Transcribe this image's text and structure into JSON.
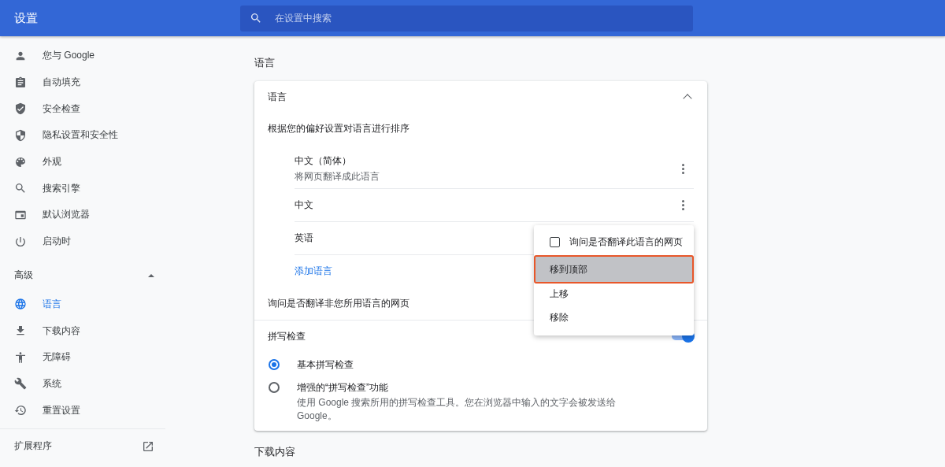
{
  "header": {
    "title": "设置",
    "search": {
      "placeholder": "在设置中搜索"
    }
  },
  "sidebar": {
    "items": [
      {
        "label": "您与 Google",
        "selected": false
      },
      {
        "label": "自动填充",
        "selected": false
      },
      {
        "label": "安全检查",
        "selected": false
      },
      {
        "label": "隐私设置和安全性",
        "selected": false
      },
      {
        "label": "外观",
        "selected": false
      },
      {
        "label": "搜索引擎",
        "selected": false
      },
      {
        "label": "默认浏览器",
        "selected": false
      },
      {
        "label": "启动时",
        "selected": false
      }
    ],
    "advanced": {
      "label": "高级",
      "expanded": true,
      "items": [
        {
          "label": "语言",
          "selected": true
        },
        {
          "label": "下载内容",
          "selected": false
        },
        {
          "label": "无障碍",
          "selected": false
        },
        {
          "label": "系统",
          "selected": false
        },
        {
          "label": "重置设置",
          "selected": false
        }
      ]
    },
    "extensions": {
      "label": "扩展程序"
    }
  },
  "main": {
    "section_title": "语言",
    "card": {
      "title": "语言",
      "expanded": true,
      "order_label": "根据您的偏好设置对语言进行排序",
      "languages": [
        {
          "name": "中文（简体）",
          "subtitle": "将网页翻译成此语言"
        },
        {
          "name": "中文"
        },
        {
          "name": "英语"
        }
      ],
      "add_link": "添加语言",
      "translate_offer": {
        "label": "询问是否翻译非您所用语言的网页"
      },
      "spellcheck": {
        "label": "拼写检查",
        "on": true,
        "options": [
          {
            "label": "基本拼写检查",
            "selected": true
          },
          {
            "label": "增强的“拼写检查”功能",
            "description": "使用 Google 搜索所用的拼写检查工具。您在浏览器中输入的文字会被发送给Google。",
            "selected": false
          }
        ]
      }
    },
    "next_section_title": "下载内容"
  },
  "menu": {
    "items": [
      {
        "kind": "checkbox",
        "label": "询问是否翻译此语言的网页",
        "checked": false
      },
      {
        "kind": "action",
        "label": "移到顶部",
        "selected": true
      },
      {
        "kind": "action",
        "label": "上移",
        "selected": false
      },
      {
        "kind": "action",
        "label": "移除",
        "selected": false
      }
    ]
  }
}
